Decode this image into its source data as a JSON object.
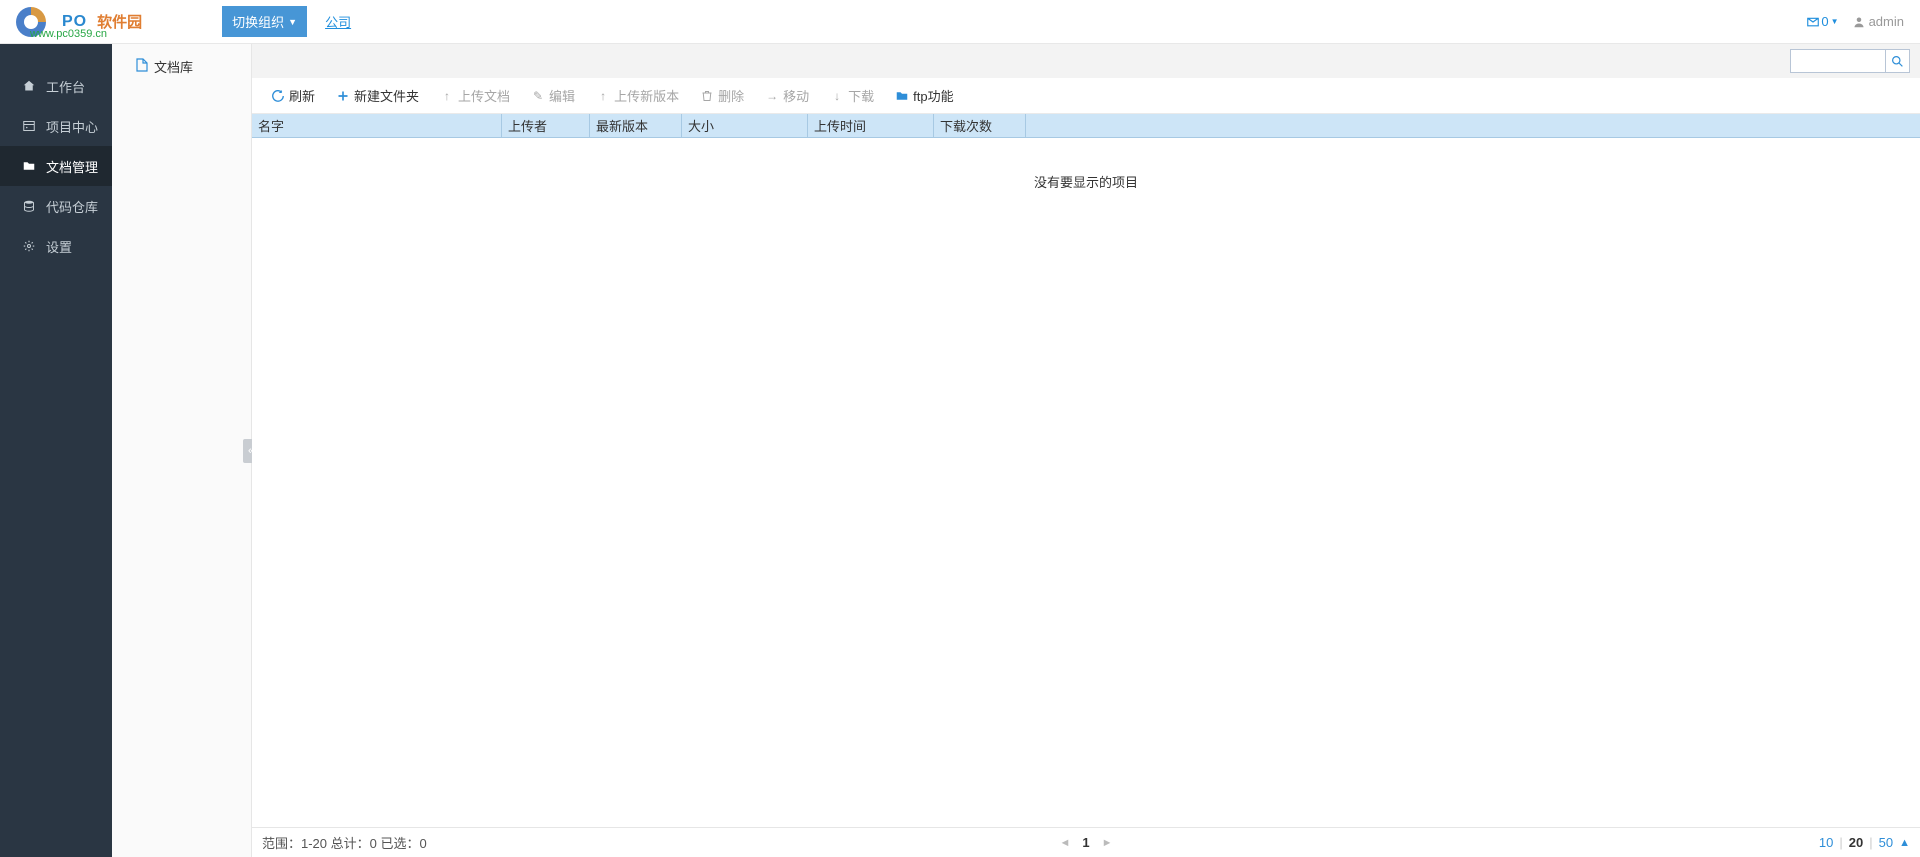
{
  "header": {
    "logo_text": "PO",
    "logo_cn": "软件园",
    "logo_domain": "www.pc0359.cn",
    "switch_org": "切换组织",
    "company": "公司",
    "mail_count": "0",
    "user": "admin"
  },
  "sidebar": {
    "items": [
      {
        "label": "工作台",
        "icon": "home"
      },
      {
        "label": "项目中心",
        "icon": "calendar"
      },
      {
        "label": "文档管理",
        "icon": "folder"
      },
      {
        "label": "代码仓库",
        "icon": "database"
      },
      {
        "label": "设置",
        "icon": "cog"
      }
    ]
  },
  "tree": {
    "root": "文档库"
  },
  "toolbar": {
    "refresh": "刷新",
    "new_folder": "新建文件夹",
    "upload_doc": "上传文档",
    "edit": "编辑",
    "upload_version": "上传新版本",
    "delete": "删除",
    "move": "移动",
    "download": "下载",
    "ftp": "ftp功能"
  },
  "table": {
    "columns": {
      "name": "名字",
      "uploader": "上传者",
      "version": "最新版本",
      "size": "大小",
      "time": "上传时间",
      "downloads": "下载次数"
    },
    "empty": "没有要显示的项目"
  },
  "footer": {
    "status": "范围：1-20 总计：0 已选：0",
    "page": "1",
    "page_sizes": [
      "10",
      "20",
      "50"
    ],
    "page_size_current": "20"
  },
  "search": {
    "placeholder": ""
  }
}
